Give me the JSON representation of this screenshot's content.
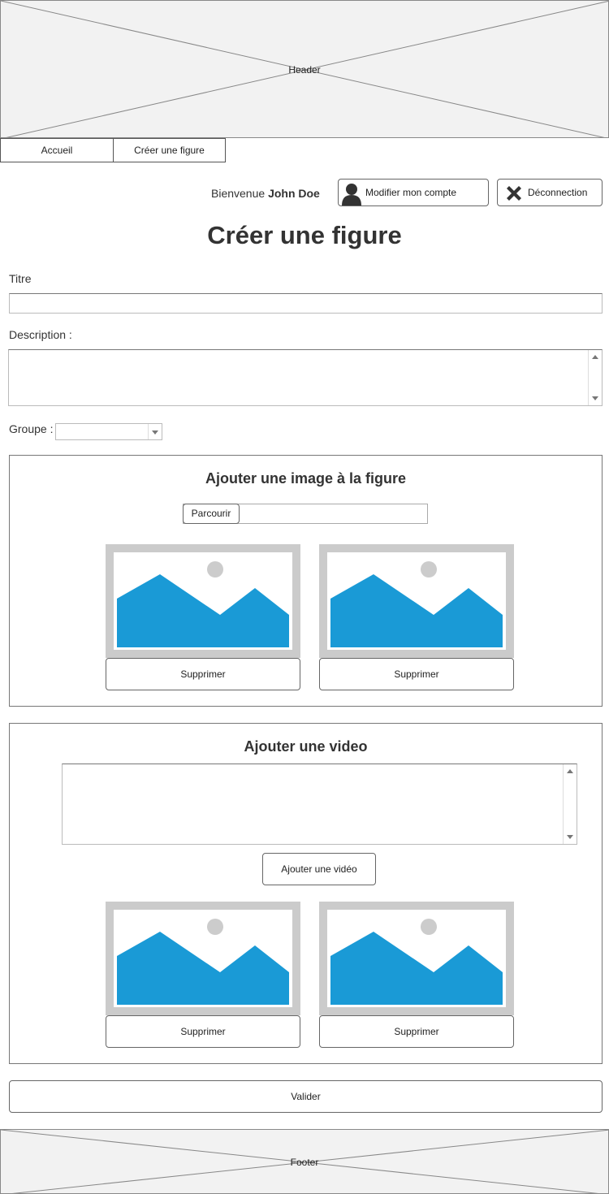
{
  "header": {
    "label": "Header"
  },
  "nav": {
    "items": [
      {
        "label": "Accueil"
      },
      {
        "label": "Créer une figure"
      }
    ]
  },
  "user": {
    "welcome_prefix": "Bienvenue",
    "name": "John Doe",
    "edit_account_label": "Modifier mon compte",
    "logout_label": "Déconnection"
  },
  "page": {
    "title": "Créer une figure"
  },
  "form": {
    "title_label": "Titre",
    "title_value": "",
    "description_label": "Description :",
    "description_value": "",
    "group_label": "Groupe :",
    "group_value": ""
  },
  "images_section": {
    "title": "Ajouter une image à la figure",
    "browse_label": "Parcourir",
    "file_value": "",
    "items": [
      {
        "delete_label": "Supprimer"
      },
      {
        "delete_label": "Supprimer"
      }
    ]
  },
  "video_section": {
    "title": "Ajouter une video",
    "embed_value": "",
    "add_label": "Ajouter une vidéo",
    "items": [
      {
        "delete_label": "Supprimer"
      },
      {
        "delete_label": "Supprimer"
      }
    ]
  },
  "submit": {
    "label": "Valider"
  },
  "footer": {
    "label": "Footer"
  },
  "colors": {
    "image_blue": "#1a9ad6",
    "image_frame": "#cbcbcb",
    "placeholder_bg": "#f2f2f2"
  },
  "icons": {
    "edit_account": "user-icon",
    "logout": "close-x-icon",
    "image": "image-placeholder-icon"
  }
}
